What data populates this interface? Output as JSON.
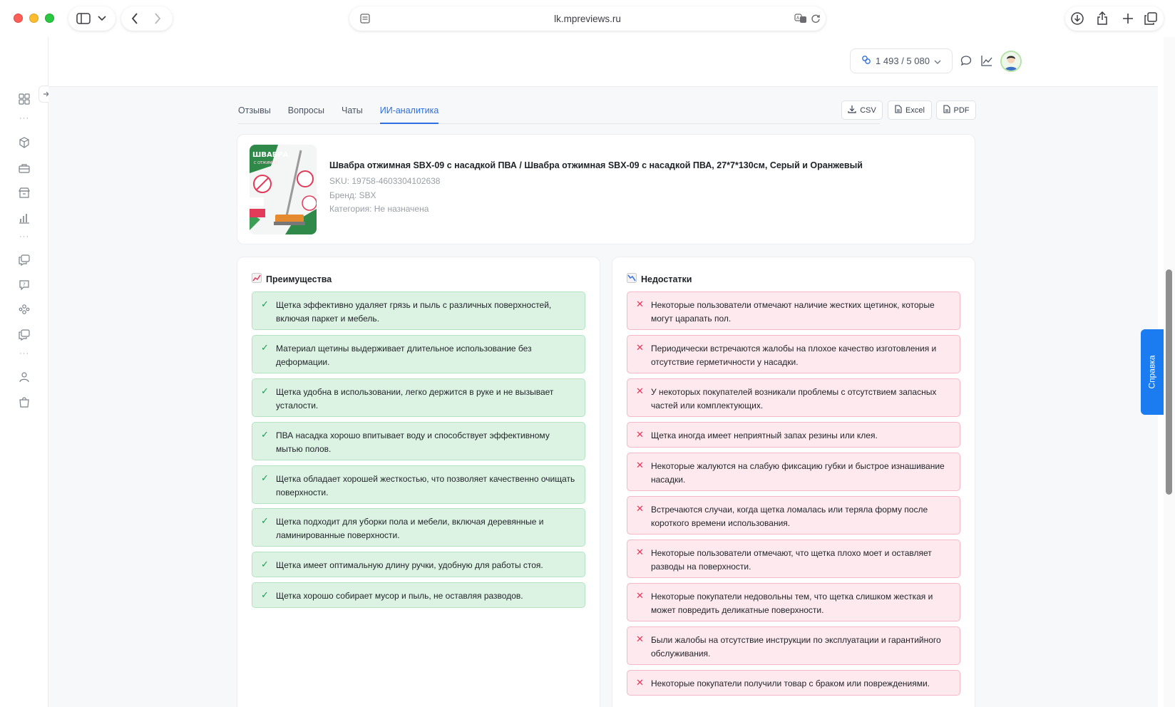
{
  "browser": {
    "url": "lk.mpreviews.ru"
  },
  "header": {
    "counter": "1 493 / 5 080"
  },
  "tabs": [
    {
      "label": "Отзывы",
      "active": false
    },
    {
      "label": "Вопросы",
      "active": false
    },
    {
      "label": "Чаты",
      "active": false
    },
    {
      "label": "ИИ-аналитика",
      "active": true
    }
  ],
  "export": {
    "csv": "CSV",
    "excel": "Excel",
    "pdf": "PDF"
  },
  "product": {
    "title": "Швабра отжимная SBX-09 с насадкой ПВА / Швабра отжимная SBX-09 с насадкой ПВА, 27*7*130см, Серый и Оранжевый",
    "sku": "SKU: 19758-4603304102638",
    "brand": "Бренд: SBX",
    "category": "Категория: Не назначена",
    "image_text": "ШВАБРА",
    "image_subtext": "С ОТЖИМОМ"
  },
  "advantages": {
    "title": "Преимущества",
    "icon": "chart-increasing-emoji",
    "items": [
      "Щетка эффективно удаляет грязь и пыль с различных поверхностей, включая паркет и мебель.",
      "Материал щетины выдерживает длительное использование без деформации.",
      "Щетка удобна в использовании, легко держится в руке и не вызывает усталости.",
      "ПВА насадка хорошо впитывает воду и способствует эффективному мытью полов.",
      "Щетка обладает хорошей жесткостью, что позволяет качественно очищать поверхности.",
      "Щетка подходит для уборки пола и мебели, включая деревянные и ламинированные поверхности.",
      "Щетка имеет оптимальную длину ручки, удобную для работы стоя.",
      "Щетка хорошо собирает мусор и пыль, не оставляя разводов."
    ]
  },
  "disadvantages": {
    "title": "Недостатки",
    "icon": "chart-decreasing-emoji",
    "items": [
      "Некоторые пользователи отмечают наличие жестких щетинок, которые могут царапать пол.",
      "Периодически встречаются жалобы на плохое качество изготовления и отсутствие герметичности у насадки.",
      "У некоторых покупателей возникали проблемы с отсутствием запасных частей или комплектующих.",
      "Щетка иногда имеет неприятный запах резины или клея.",
      "Некоторые жалуются на слабую фиксацию губки и быстрое изнашивание насадки.",
      "Встречаются случаи, когда щетка ломалась или теряла форму после короткого времени использования.",
      "Некоторые пользователи отмечают, что щетка плохо моет и оставляет разводы на поверхности.",
      "Некоторые покупатели недовольны тем, что щетка слишком жесткая и может повредить деликатные поверхности.",
      "Были жалобы на отсутствие инструкции по эксплуатации и гарантийного обслуживания.",
      "Некоторые покупатели получили товар с браком или повреждениями."
    ]
  },
  "help": {
    "label": "Справка"
  },
  "colors": {
    "accent": "#2f6fdf",
    "help_button": "#1a7cf0",
    "pro_bg": "#dcf3e3",
    "con_bg": "#fde9ee"
  }
}
